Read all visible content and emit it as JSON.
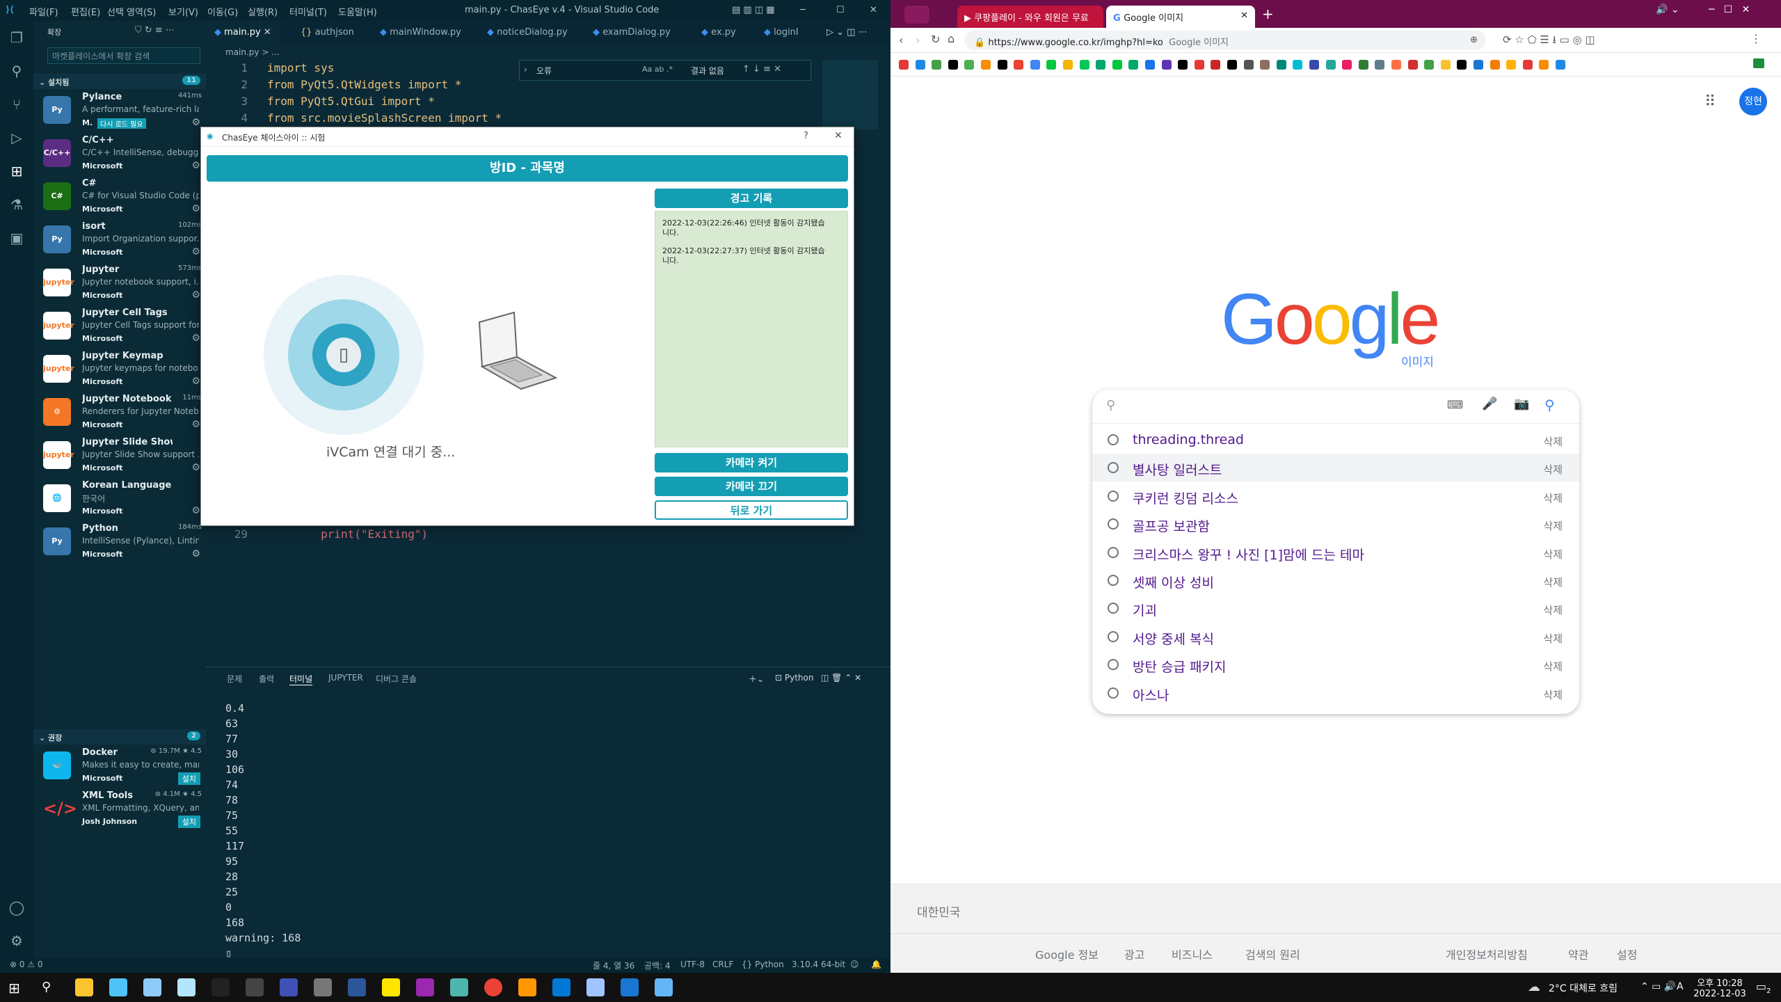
{
  "vscode": {
    "menus": [
      "파일(F)",
      "편집(E)",
      "선택 영역(S)",
      "보기(V)",
      "이동(G)",
      "실행(R)",
      "터미널(T)",
      "도움말(H)"
    ],
    "title": "main.py - ChasEye v.4 - Visual Studio Code",
    "sidebar_title": "확장",
    "search_placeholder": "마켓플레이스에서 확장 검색",
    "installed_label": "설치됨",
    "installed_count": "11",
    "reload_badge": "다시 로드 필요",
    "extensions": [
      {
        "name": "Pylance",
        "desc": "A performant, feature-rich la...",
        "publisher": "M.",
        "time": "441ms"
      },
      {
        "name": "C/C++",
        "desc": "C/C++ IntelliSense, debuggi...",
        "publisher": "Microsoft",
        "time": ""
      },
      {
        "name": "C#",
        "desc": "C# for Visual Studio Code (p...",
        "publisher": "Microsoft",
        "time": ""
      },
      {
        "name": "isort",
        "desc": "Import Organization suppor...",
        "publisher": "Microsoft",
        "time": "102ms"
      },
      {
        "name": "Jupyter",
        "desc": "Jupyter notebook support, i...",
        "publisher": "Microsoft",
        "time": "573ms"
      },
      {
        "name": "Jupyter Cell Tags",
        "desc": "Jupyter Cell Tags support for...",
        "publisher": "Microsoft",
        "time": ""
      },
      {
        "name": "Jupyter Keymap",
        "desc": "Jupyter keymaps for notebo...",
        "publisher": "Microsoft",
        "time": ""
      },
      {
        "name": "Jupyter Notebook ...",
        "desc": "Renderers for Jupyter Noteb...",
        "publisher": "Microsoft",
        "time": "11ms"
      },
      {
        "name": "Jupyter Slide Show",
        "desc": "Jupyter Slide Show support ...",
        "publisher": "Microsoft",
        "time": ""
      },
      {
        "name": "Korean Language Pack for...",
        "desc": "한국어",
        "publisher": "Microsoft",
        "time": ""
      },
      {
        "name": "Python",
        "desc": "IntelliSense (Pylance), Lintin...",
        "publisher": "Microsoft",
        "time": "184ms"
      }
    ],
    "recommended_label": "권장",
    "recommended_count": "2",
    "recommended": [
      {
        "name": "Docker",
        "desc": "Makes it easy to create, man...",
        "publisher": "Microsoft",
        "downloads": "19.7M",
        "rating": "4.5",
        "install": "설치"
      },
      {
        "name": "XML Tools",
        "desc": "XML Formatting, XQuery, an...",
        "publisher": "Josh Johnson",
        "downloads": "4.1M",
        "rating": "4.5",
        "install": "설치"
      }
    ],
    "tabs": [
      "main.py",
      "authjson",
      "mainWindow.py",
      "noticeDialog.py",
      "examDialog.py",
      "ex.py",
      "loginI"
    ],
    "breadcrumb": "main.py > ...",
    "code": [
      {
        "n": "1",
        "t": "import sys"
      },
      {
        "n": "2",
        "t": "from PyQt5.QtWidgets import *"
      },
      {
        "n": "3",
        "t": "from PyQt5.QtGui import *"
      },
      {
        "n": "4",
        "t": "from src.movieSplashScreen import *"
      },
      {
        "n": "29",
        "t": "        print(\"Exiting\")"
      }
    ],
    "find": {
      "value": "오류",
      "result": "결과 없음"
    },
    "panel_tabs": [
      "문제",
      "출력",
      "터미널",
      "JUPYTER",
      "디버그 콘솔"
    ],
    "panel_python": "Python",
    "terminal": [
      "0.4",
      "63",
      "77",
      "30",
      "106",
      "74",
      "78",
      "75",
      "55",
      "117",
      "95",
      "28",
      "25",
      "0",
      "168",
      "warning: 168"
    ],
    "status": {
      "problems": "⊗ 0 ⚠ 0",
      "pos": "줄 4, 열 36",
      "spaces": "공백: 4",
      "enc": "UTF-8",
      "eol": "CRLF",
      "lang": "Python",
      "ver": "3.10.4 64-bit"
    }
  },
  "dialog": {
    "title": "ChasEye 체이스아이 :: 시험",
    "help": "?",
    "close": "✕",
    "header": "방ID - 과목명",
    "log_header": "경고 기록",
    "logs": [
      "2022-12-03(22:26:46) 인터넷 활동이 감지됐습니다.",
      "2022-12-03(22:27:37) 인터넷 활동이 감지됐습니다."
    ],
    "waiting": "iVCam 연결 대기 중...",
    "camera_on": "카메라 켜기",
    "camera_off": "카메라 끄기",
    "back": "뒤로 가기"
  },
  "chrome": {
    "tabs": [
      "쿠팡플레이 - 와우 회원은 무료",
      "Google 이미지"
    ],
    "url": "https://www.google.co.kr/imghp?hl=ko",
    "url_hint": "Google 이미지",
    "profile": "정현",
    "logo": "Google",
    "logo_sub": "이미지",
    "suggestions": [
      "threading.thread",
      "별사탕 일러스트",
      "쿠키런 킹덤 리소스",
      "골프공 보관함",
      "크리스마스 왕꾸 ! 사진 [1]맘에 드는 테마",
      "셋째 이상 성비",
      "기괴",
      "서양 중세 복식",
      "방탄 승급 패키지",
      "아스나"
    ],
    "delete_label": "삭제",
    "country": "대한민국",
    "footer_left": [
      "Google 정보",
      "광고",
      "비즈니스",
      "검색의 원리"
    ],
    "footer_right": [
      "개인정보처리방침",
      "약관",
      "설정"
    ]
  },
  "taskbar": {
    "weather": "2°C 대체로 흐림",
    "time": "오후 10:28",
    "date": "2022-12-03",
    "lang": "A",
    "notif": "2"
  },
  "colors": {
    "accent": "#139eb4",
    "chrome_frame": "#6b0e4a",
    "vscode_bg": "#0d2e3c"
  }
}
